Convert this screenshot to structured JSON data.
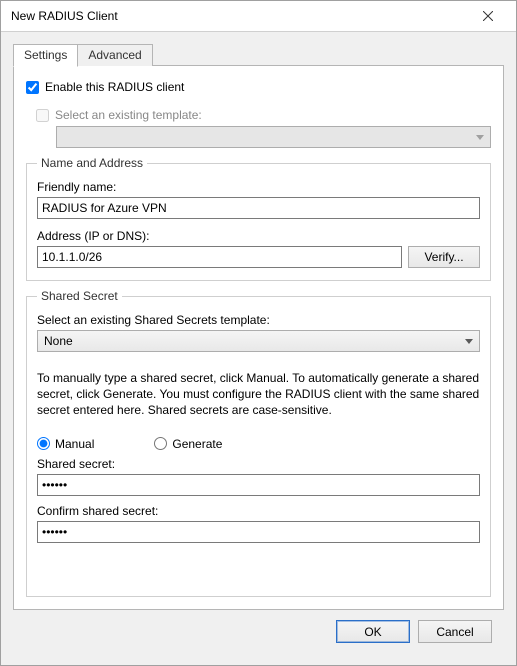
{
  "window": {
    "title": "New RADIUS Client"
  },
  "tabs": {
    "settings": "Settings",
    "advanced": "Advanced"
  },
  "enable": {
    "label": "Enable this RADIUS client",
    "checked": true
  },
  "existing_template": {
    "label": "Select an existing template:",
    "checked": false,
    "value": ""
  },
  "name_address": {
    "legend": "Name and Address",
    "friendly_label": "Friendly name:",
    "friendly_value": "RADIUS for Azure VPN",
    "address_label": "Address (IP or DNS):",
    "address_value": "10.1.1.0/26",
    "verify_label": "Verify..."
  },
  "shared_secret": {
    "legend": "Shared Secret",
    "template_label": "Select an existing Shared Secrets template:",
    "template_value": "None",
    "info": "To manually type a shared secret, click Manual. To automatically generate a shared secret, click Generate. You must configure the RADIUS client with the same shared secret entered here. Shared secrets are case-sensitive.",
    "radio_manual": "Manual",
    "radio_generate": "Generate",
    "mode": "manual",
    "secret_label": "Shared secret:",
    "secret_value": "••••••",
    "confirm_label": "Confirm shared secret:",
    "confirm_value": "••••••"
  },
  "footer": {
    "ok": "OK",
    "cancel": "Cancel"
  }
}
